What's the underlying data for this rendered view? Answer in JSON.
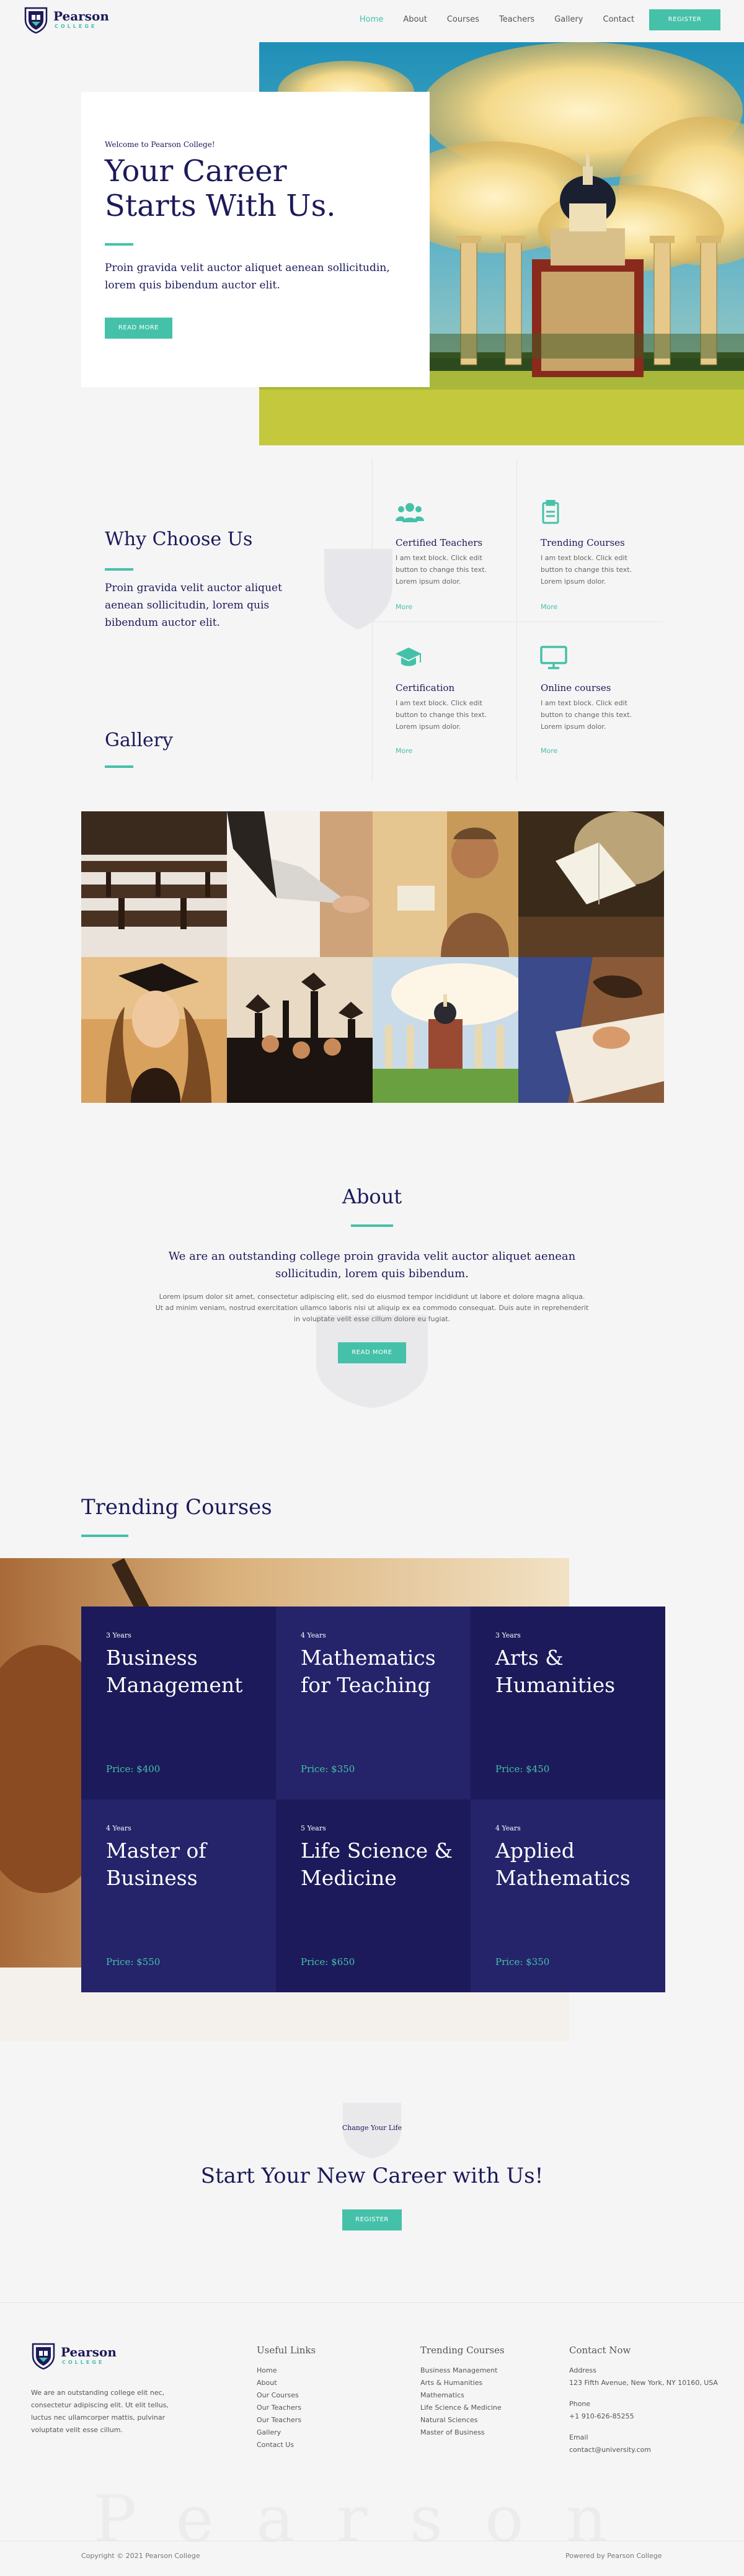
{
  "header": {
    "logo_name": "Pearson",
    "logo_sub": "COLLEGE",
    "nav": [
      {
        "label": "Home",
        "active": true
      },
      {
        "label": "About"
      },
      {
        "label": "Courses"
      },
      {
        "label": "Teachers"
      },
      {
        "label": "Gallery"
      },
      {
        "label": "Contact"
      }
    ],
    "register_label": "REGISTER"
  },
  "hero": {
    "welcome": "Welcome to Pearson College!",
    "title": "Your Career Starts With Us.",
    "text": "Proin gravida velit auctor aliquet aenean sollicitudin, lorem quis bibendum auctor elit.",
    "button": "READ MORE"
  },
  "why": {
    "title": "Why Choose Us",
    "text": "Proin gravida velit auctor aliquet aenean sollicitudin, lorem quis bibendum auctor elit.",
    "features": [
      {
        "icon": "teachers-icon",
        "title": "Certified Teachers",
        "text": "I am text block. Click edit button to change this text. Lorem ipsum dolor.",
        "more": "More"
      },
      {
        "icon": "clipboard-icon",
        "title": "Trending Courses",
        "text": "I am text block. Click edit button to change this text. Lorem ipsum dolor.",
        "more": "More"
      },
      {
        "icon": "graduation-cap-icon",
        "title": "Certification",
        "text": "I am text block. Click edit button to change this text. Lorem ipsum dolor.",
        "more": "More"
      },
      {
        "icon": "monitor-icon",
        "title": "Online courses",
        "text": "I am text block. Click edit button to change this text. Lorem ipsum dolor.",
        "more": "More"
      }
    ]
  },
  "gallery": {
    "title": "Gallery"
  },
  "about": {
    "title": "About",
    "lead": "We are an outstanding college proin gravida velit auctor aliquet aenean sollicitudin, lorem quis bibendum.",
    "body": "Lorem ipsum dolor sit amet, consectetur adipiscing elit, sed do eiusmod tempor incididunt ut labore et dolore magna aliqua. Ut ad minim veniam, nostrud exercitation ullamco laboris nisi ut aliquip ex ea commodo consequat. Duis aute in reprehenderit in voluptate velit esse cillum dolore eu fugiat.",
    "button": "READ MORE"
  },
  "trending": {
    "title": "Trending Courses",
    "courses": [
      {
        "years": "3 Years",
        "name": "Business Management",
        "price": "Price: $400"
      },
      {
        "years": "4 Years",
        "name": "Mathematics for Teaching",
        "price": "Price: $350"
      },
      {
        "years": "3 Years",
        "name": "Arts & Humanities",
        "price": "Price: $450"
      },
      {
        "years": "4 Years",
        "name": "Master of Business",
        "price": "Price: $550"
      },
      {
        "years": "5 Years",
        "name": "Life Science & Medicine",
        "price": "Price: $650"
      },
      {
        "years": "4 Years",
        "name": "Applied Mathematics",
        "price": "Price: $350"
      }
    ]
  },
  "cta": {
    "small": "Change Your Life",
    "title": "Start Your New Career with Us!",
    "button": "REGISTER"
  },
  "footer": {
    "about": "We are an outstanding college elit nec, consectetur adipiscing elit. Ut elit tellus, luctus nec ullamcorper mattis, pulvinar voluptate velit esse cillum.",
    "useful_title": "Useful Links",
    "useful_links": [
      "Home",
      "About",
      "Our Courses",
      "Our Teachers",
      "Our Teachers",
      "Gallery",
      "Contact Us"
    ],
    "trending_title": "Trending Courses",
    "trending_links": [
      "Business Management",
      "Arts & Humanities",
      "Mathematics",
      "Life Science & Medicine",
      "Natural Sciences",
      "Master of Business"
    ],
    "contact_title": "Contact Now",
    "address_label": "Address",
    "address": "123 Fifth Avenue, New York, NY 10160, USA",
    "phone_label": "Phone",
    "phone": "+1 910-626-85255",
    "email_label": "Email",
    "email": "contact@university.com",
    "watermark": "Pearson",
    "copyright": "Copyright © 2021 Pearson College",
    "powered": "Powered by Pearson College"
  },
  "colors": {
    "accent": "#45c1a9",
    "navy": "#1c1a5a",
    "navy_alt": "#25236a"
  }
}
